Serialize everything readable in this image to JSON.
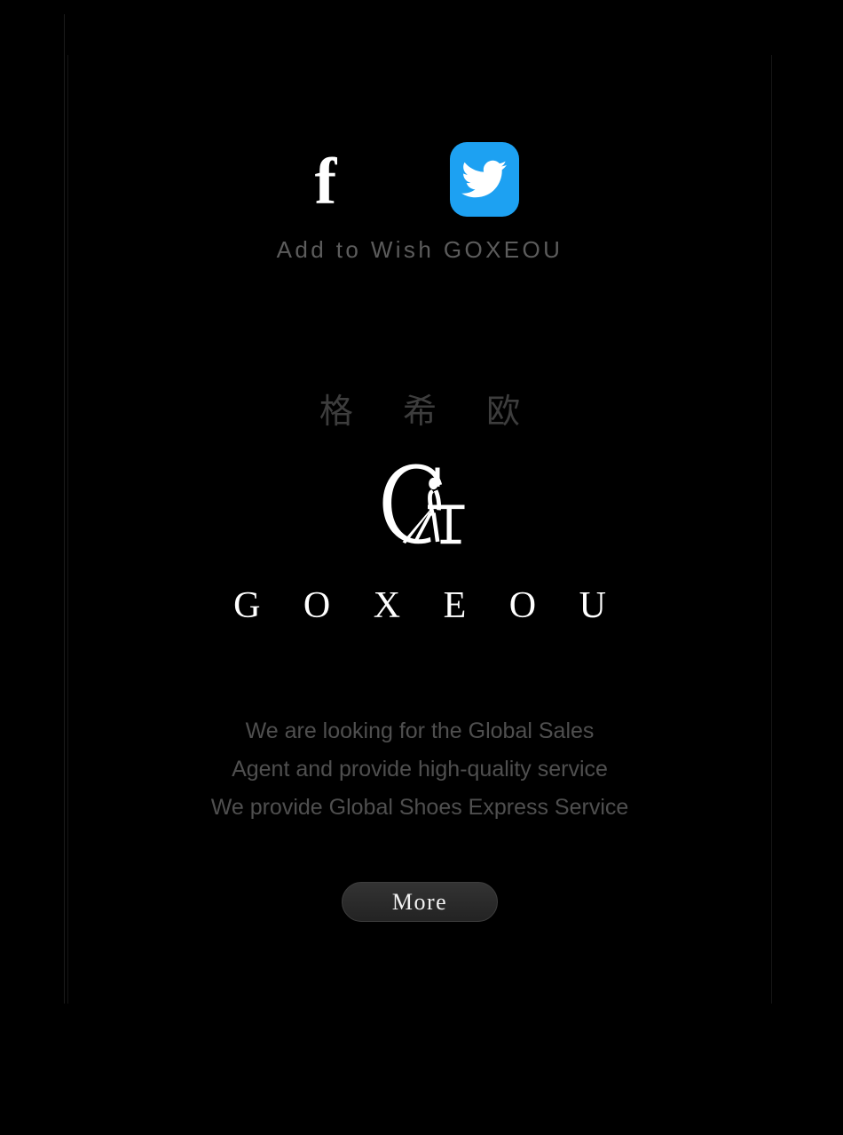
{
  "page": {
    "background_color": "#000000",
    "frame_border_color": "#151515"
  },
  "social": {
    "facebook": {
      "name": "facebook-icon",
      "glyph": "f",
      "color": "#3b5a9b"
    },
    "twitter": {
      "name": "twitter-icon",
      "color": "#1da1f2"
    }
  },
  "wish": {
    "label": "Add to Wish GOXEOU",
    "color": "#5c5c5c"
  },
  "brand": {
    "chinese_name": "格 希 欧",
    "chinese_color": "#3d3d3d",
    "logo_icon": "goxeou-g-figure-logo",
    "logo_color": "#ffffff",
    "wordmark": "G O X E O U",
    "wordmark_color": "#ffffff"
  },
  "tagline": {
    "color": "#4f4f4f",
    "lines": [
      "We are looking for the Global Sales",
      "Agent and provide high-quality service",
      "We provide Global Shoes Express Service"
    ]
  },
  "actions": {
    "more_label": "More",
    "more_color": "#f2f2f2"
  }
}
